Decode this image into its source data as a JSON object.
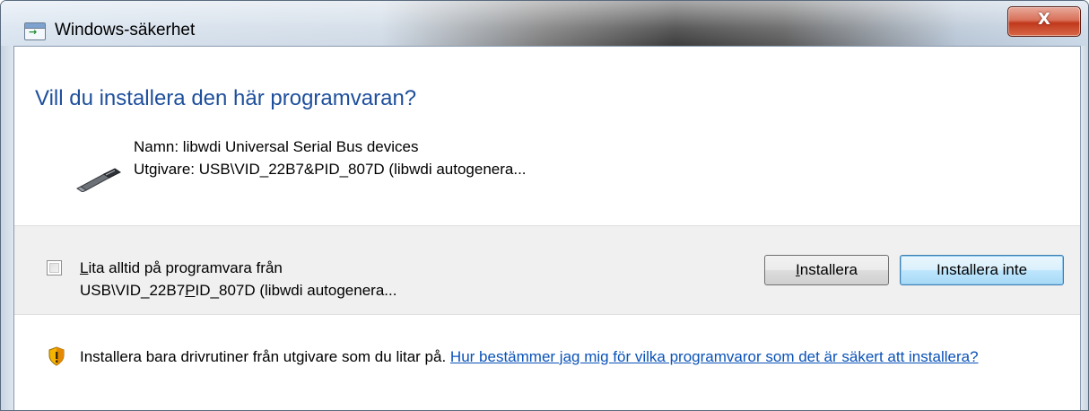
{
  "window": {
    "title": "Windows-säkerhet",
    "close_label": "X"
  },
  "dialog": {
    "question": "Vill du installera den här programvaran?",
    "name_line": "Namn: libwdi Universal Serial Bus devices",
    "publisher_line": "Utgivare: USB\\VID_22B7&PID_807D (libwdi autogenera..."
  },
  "trust": {
    "checkbox_checked": false,
    "line1_accesskey": "L",
    "line1_rest": "ita alltid på programvara från",
    "line2_before": "USB\\VID_22B7",
    "line2_accesskey": "P",
    "line2_after": "ID_807D (libwdi autogenera..."
  },
  "buttons": {
    "install_accesskey": "I",
    "install_rest": "nstallera",
    "dont_install": "Installera inte"
  },
  "footer": {
    "warning_text": "Installera bara drivrutiner från utgivare som du litar på. ",
    "help_link": "Hur bestämmer jag mig för vilka programvaror som det är säkert att installera?"
  },
  "colors": {
    "heading": "#1e4f9c",
    "link": "#0a52b8",
    "close_button": "#c1381c"
  }
}
